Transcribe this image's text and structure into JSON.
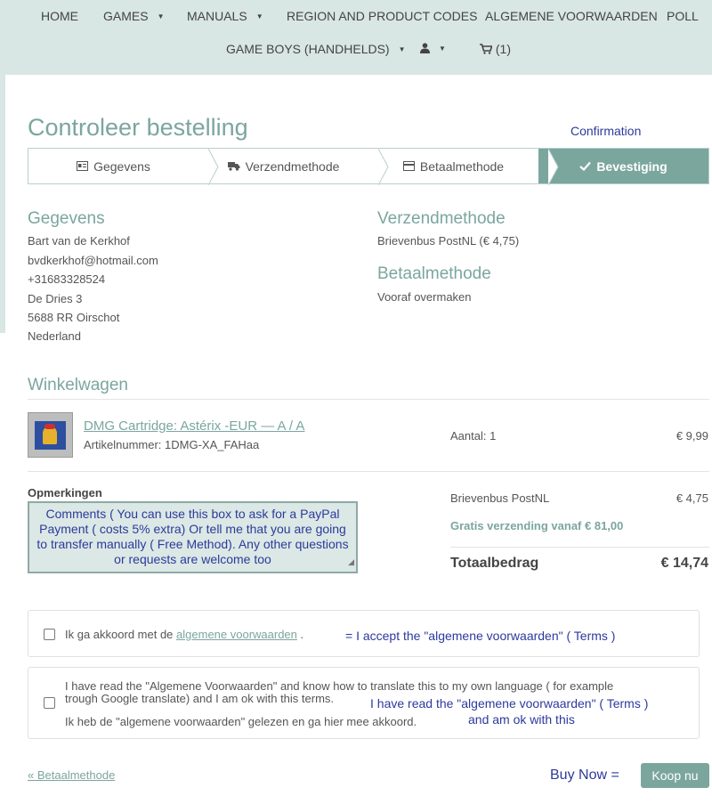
{
  "nav": {
    "home": "HOME",
    "games": "GAMES",
    "manuals": "MANUALS",
    "region": "REGION AND PRODUCT CODES",
    "terms": "ALGEMENE VOORWAARDEN",
    "poll": "POLL",
    "gameboys": "GAME BOYS (HANDHELDS)",
    "cart_count": "(1)"
  },
  "page": {
    "title": "Controleer bestelling",
    "confirmation_annotation": "Confirmation"
  },
  "steps": [
    {
      "label": "Gegevens",
      "icon": "id-card-icon"
    },
    {
      "label": "Verzendmethode",
      "icon": "truck-icon"
    },
    {
      "label": "Betaalmethode",
      "icon": "credit-card-icon"
    },
    {
      "label": "Bevestiging",
      "icon": "checkmark-icon"
    }
  ],
  "gegevens": {
    "title": "Gegevens",
    "lines": [
      "Bart van de Kerkhof",
      "bvdkerkhof@hotmail.com",
      "+31683328524",
      "De Dries 3",
      "5688 RR Oirschot",
      "Nederland"
    ]
  },
  "verzendmethode": {
    "title": "Verzendmethode",
    "value": "Brievenbus PostNL (€ 4,75)"
  },
  "betaalmethode": {
    "title": "Betaalmethode",
    "value": "Vooraf overmaken"
  },
  "cart": {
    "title": "Winkelwagen",
    "product_name": "DMG Cartridge: Astérix -EUR — A / A",
    "article_number": "Artikelnummer: 1DMG-XA_FAHaa",
    "quantity": "Aantal: 1",
    "price": "€ 9,99"
  },
  "remarks": {
    "label": "Opmerkingen",
    "text": "Comments ( You can use this box to ask for a PayPal Payment ( costs 5% extra) Or tell me that you are going to transfer manually ( Free Method). Any other questions or requests are welcome too"
  },
  "summary": {
    "shipping_label": "Brievenbus PostNL",
    "shipping_price": "€ 4,75",
    "free_shipping": "Gratis verzending vanaf € 81,00",
    "total_label": "Totaalbedrag",
    "total_value": "€ 14,74"
  },
  "terms": {
    "prefix": "Ik ga akkoord met de",
    "link": "algemene voorwaarden",
    "suffix": ".",
    "annotation": "= I accept the \"algemene voorwaarden\" ( Terms )"
  },
  "read_terms": {
    "english_line1": "I have read the \"Algemene Voorwaarden\" and know how to translate this to my own language ( for example",
    "english_line2": "trough Google translate) and I am ok with this terms.",
    "dutch_line": "Ik heb de \"algemene voorwaarden\" gelezen en ga hier mee akkoord.",
    "annotation_line1": "I have read the \"algemene voorwaarden\" ( Terms )",
    "annotation_line2": "and am ok with this"
  },
  "footer": {
    "back_link": "« Betaalmethode",
    "buy_now_annotation": "Buy Now =",
    "buy_button": "Koop nu"
  },
  "colors": {
    "accent": "#7ba69e",
    "topbar": "#d8e6e4",
    "annotation": "#2c3a9c"
  }
}
